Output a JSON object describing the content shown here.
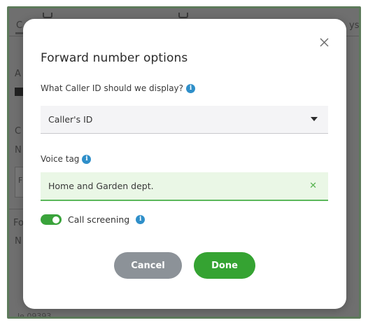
{
  "background_app": {
    "fragments": [
      "C",
      "ys",
      "A",
      "C",
      "N",
      "F",
      "Fo",
      "N",
      "le 09393"
    ]
  },
  "modal": {
    "title": "Forward number options",
    "caller_id": {
      "label": "What Caller ID should we display?",
      "selected_value": "Caller's ID"
    },
    "voice_tag": {
      "label": "Voice tag",
      "value": "Home and Garden dept."
    },
    "call_screening": {
      "label": "Call screening",
      "enabled": true
    },
    "buttons": {
      "cancel_label": "Cancel",
      "done_label": "Done"
    }
  },
  "colors": {
    "accent_green": "#35a332",
    "info_blue": "#2f8fc9",
    "cancel_gray": "#8c9298",
    "input_highlight": "#eaf7e6"
  },
  "icons": {
    "close": "close-icon",
    "info": "info-icon",
    "dropdown": "caret-down-icon",
    "clear": "clear-icon"
  }
}
